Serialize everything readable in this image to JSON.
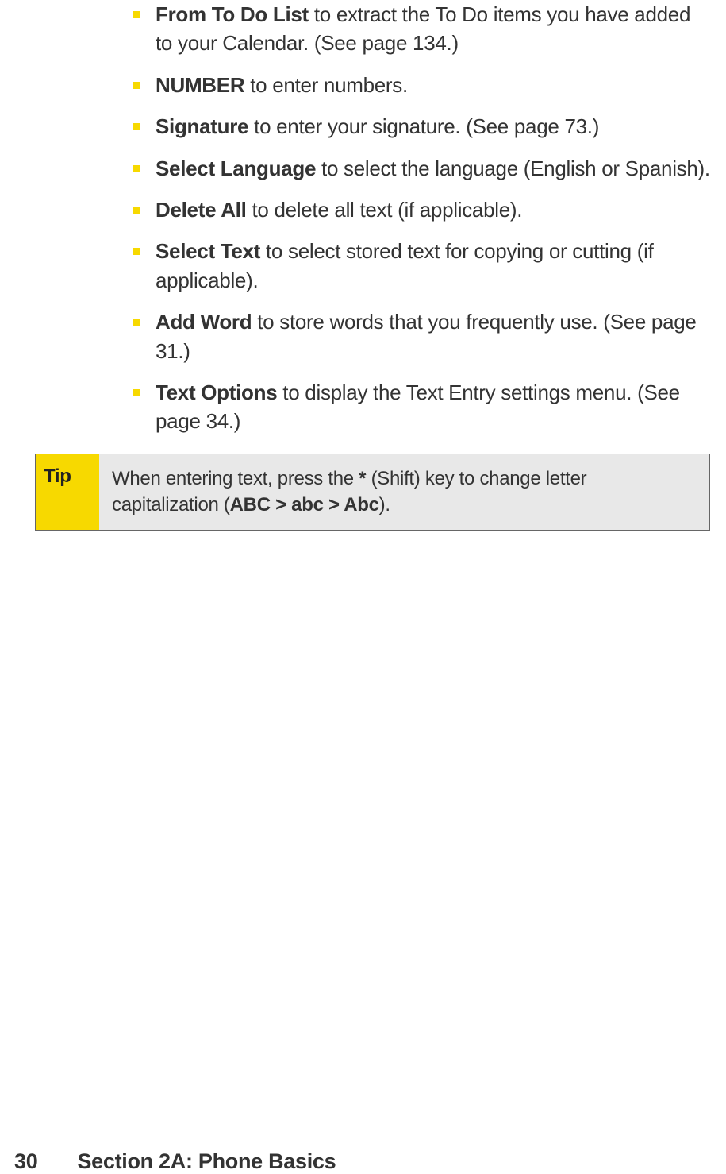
{
  "list": {
    "items": [
      {
        "bold": "From To Do List",
        "rest": " to extract the To Do items you have added to your Calendar. (See page 134.)"
      },
      {
        "bold": "NUMBER",
        "rest": " to enter numbers."
      },
      {
        "bold": "Signature",
        "rest": " to enter your signature. (See page 73.)"
      },
      {
        "bold": "Select Language",
        "rest": " to select the language (English or Spanish)."
      },
      {
        "bold": "Delete All",
        "rest": " to delete all text (if applicable)."
      },
      {
        "bold": "Select Text",
        "rest": " to select stored text for copying or cutting (if applicable)."
      },
      {
        "bold": "Add Word",
        "rest": " to store words that you frequently use. (See page 31.)"
      },
      {
        "bold": "Text Options",
        "rest": " to display the Text Entry settings menu. (See page 34.)"
      }
    ]
  },
  "tip": {
    "label": "Tip",
    "text_before": "When entering text, press the ",
    "symbol": "*",
    "text_mid": " (Shift) key to change letter capitalization (",
    "bold_text": "ABC > abc > Abc",
    "text_after": ")."
  },
  "footer": {
    "page_number": "30",
    "section": "Section 2A: Phone Basics"
  }
}
